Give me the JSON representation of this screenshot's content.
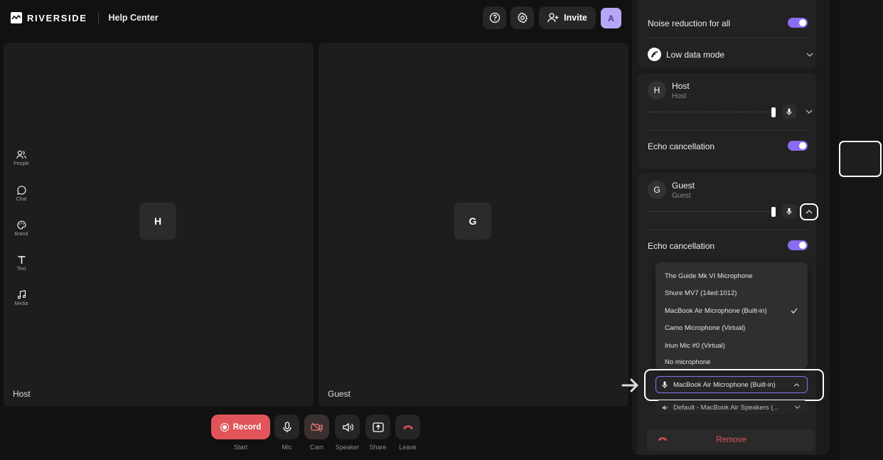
{
  "header": {
    "brand": "RIVERSIDE",
    "help_center": "Help Center",
    "invite_label": "Invite",
    "avatar_initial": "A"
  },
  "tiles": {
    "host": {
      "initial": "H",
      "label": "Host"
    },
    "guest": {
      "initial": "G",
      "label": "Guest"
    }
  },
  "controls": {
    "record_label": "Record",
    "record_sub": "Start",
    "mic": "Mic",
    "cam": "Cam",
    "speaker": "Speaker",
    "share": "Share",
    "leave": "Leave"
  },
  "panel": {
    "noise_reduction": "Noise reduction for all",
    "low_data_mode": "Low data mode",
    "host": {
      "initial": "H",
      "name": "Host",
      "role": "Host",
      "echo": "Echo cancellation",
      "volume": 1.0
    },
    "guest": {
      "initial": "G",
      "name": "Guest",
      "role": "Guest",
      "echo": "Echo cancellation",
      "volume": 1.0
    },
    "mic_options": [
      "The Guide Mk VI Microphone",
      "Shure MV7 (14ed:1012)",
      "MacBook Air Microphone (Built-in)",
      "Camo Microphone (Virtual)",
      "Iriun Mic #0 (Virtual)",
      "No microphone"
    ],
    "selected_mic": "MacBook Air Microphone (Built-in)",
    "speaker_select": "Default - MacBook Air Speakers (...",
    "remove_label": "Remove"
  },
  "sidebar": {
    "items": [
      {
        "label": "People",
        "icon": "people-icon"
      },
      {
        "label": "Chat",
        "icon": "chat-icon"
      },
      {
        "label": "Brand",
        "icon": "palette-icon"
      },
      {
        "label": "Text",
        "icon": "text-icon"
      },
      {
        "label": "Media",
        "icon": "music-icon"
      }
    ]
  },
  "colors": {
    "accent": "#8b6cf0",
    "record": "#e0545a",
    "avatar": "#b7a6f5"
  }
}
